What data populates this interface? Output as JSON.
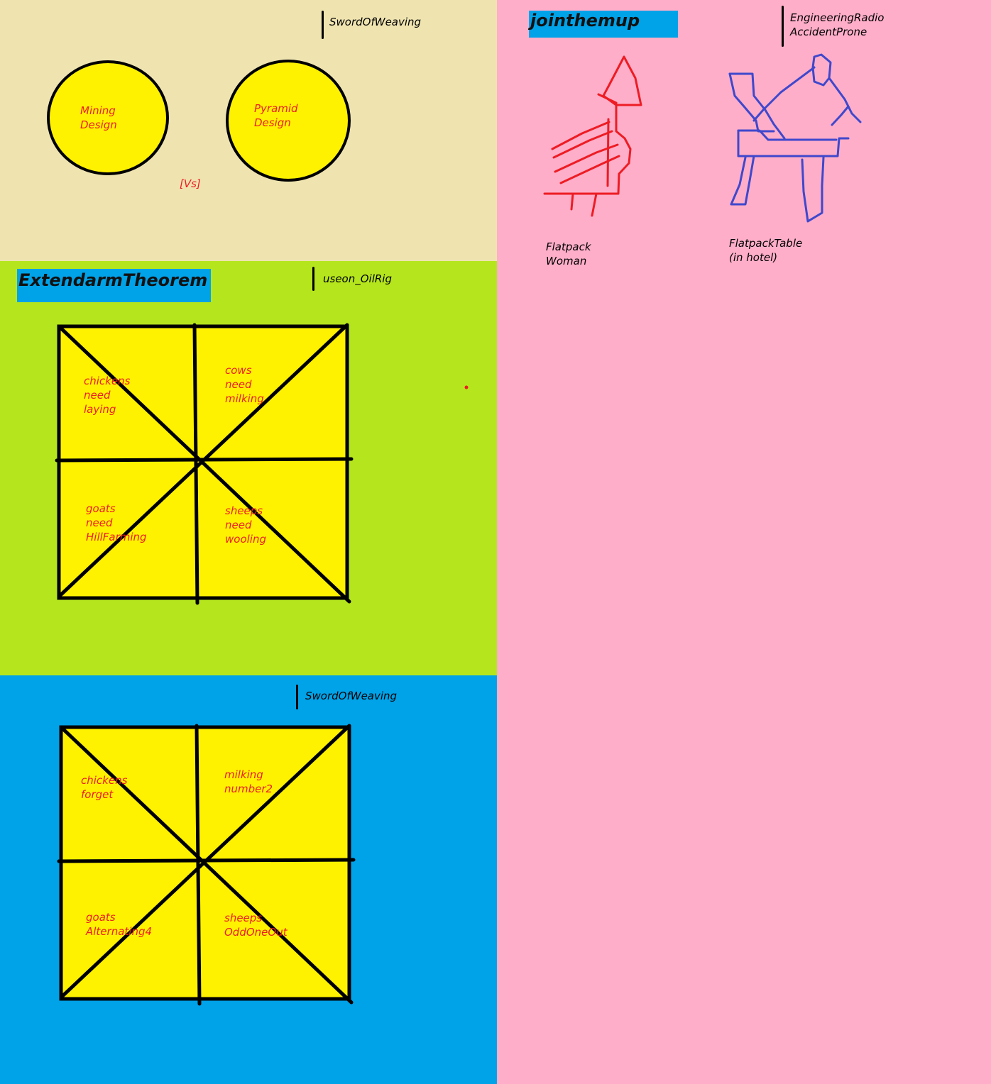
{
  "panel_top": {
    "author": "SwordOfWeaving",
    "circle_left_label": "Mining\nDesign",
    "circle_right_label": "Pyramid\nDesign",
    "vs_label": "[Vs]"
  },
  "panel_green": {
    "title": "ExtendarmTheorem",
    "author": "useon_OilRig",
    "cells": {
      "top_left": "chickens\nneed\nlaying",
      "top_right": "cows\nneed\nmilking",
      "bottom_left": "goats\nneed\nHillFarming",
      "bottom_right": "sheeps\nneed\nwooling"
    }
  },
  "panel_blue": {
    "author": "SwordOfWeaving",
    "cells": {
      "top_left": "chickens\nforget",
      "top_right": "milking\nnumber2",
      "bottom_left": "goats\nAlternating4",
      "bottom_right": "sheeps\nOddOneOut"
    }
  },
  "panel_pink": {
    "title": "jointhemup",
    "author": "EngineeringRadio\nAccidentProne",
    "drawing_left_label": "Flatpack\nWoman",
    "drawing_right_label": "FlatpackTable\n(in hotel)"
  },
  "colors": {
    "beige": "#efe4b0",
    "green": "#b5e61d",
    "blue": "#00a2e8",
    "pink": "#ffaec9",
    "yellow": "#fff200",
    "red": "#ed1c24",
    "drawing_blue": "#3f48cc"
  }
}
